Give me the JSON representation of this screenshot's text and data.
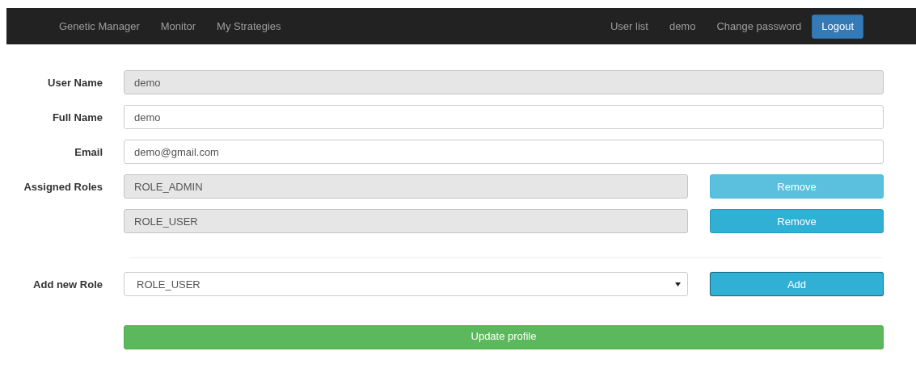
{
  "navbar": {
    "left_links": [
      "Genetic Manager",
      "Monitor",
      "My Strategies"
    ],
    "right_links": [
      "User list",
      "demo",
      "Change password"
    ],
    "logout_button": "Logout"
  },
  "form": {
    "fields": [
      {
        "label": "User Name",
        "value": "demo",
        "disabled": true
      },
      {
        "label": "Full Name",
        "value": "demo",
        "disabled": false
      },
      {
        "label": "Email",
        "value": "demo@gmail.com",
        "disabled": false
      }
    ],
    "assigned_roles": {
      "label": "Assigned Roles",
      "roles": [
        {
          "value": "ROLE_ADMIN",
          "button": "Remove",
          "hovered": true
        },
        {
          "value": "ROLE_USER",
          "button": "Remove",
          "hovered": false
        }
      ]
    },
    "add_role": {
      "label": "Add new Role",
      "selected_value": "ROLE_USER",
      "button": "Add",
      "focused": true
    },
    "submit_button": "Update profile"
  }
}
